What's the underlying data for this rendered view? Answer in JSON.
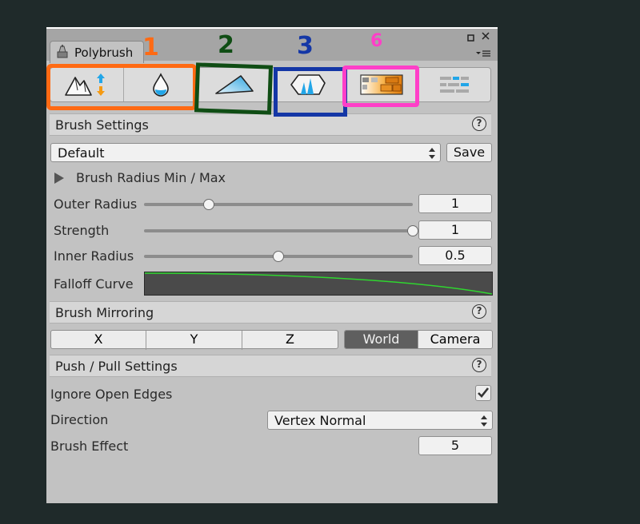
{
  "window": {
    "tab_title": "Polybrush",
    "tab_icon": "polybrush-icon",
    "controls": [
      "lock-icon",
      "close-icon",
      "menu-icon"
    ]
  },
  "modes": [
    {
      "name": "sculpt-mode",
      "icon": "mountain-arrows-icon"
    },
    {
      "name": "smooth-mode",
      "icon": "water-drop-icon"
    },
    {
      "name": "paint-vertex-mode",
      "icon": "triangle-icon"
    },
    {
      "name": "scatter-prefab-mode",
      "icon": "gem-prefab-icon"
    },
    {
      "name": "paint-texture-mode",
      "icon": "texture-blocks-icon"
    },
    {
      "name": "settings-mode",
      "icon": "list-settings-icon"
    }
  ],
  "annotations": [
    {
      "label": "1",
      "color": "#ff6a13"
    },
    {
      "label": "2",
      "color": "#0f4d14"
    },
    {
      "label": "3",
      "color": "#1437a6"
    },
    {
      "label": "6",
      "color": "#ff3fc8"
    }
  ],
  "brush_settings": {
    "header": "Brush Settings",
    "preset": "Default",
    "save_label": "Save",
    "radius_minmax": "Brush Radius Min / Max",
    "outer_radius": {
      "label": "Outer Radius",
      "value": "1",
      "fraction": 0.24
    },
    "strength": {
      "label": "Strength",
      "value": "1",
      "fraction": 1.0
    },
    "inner_radius": {
      "label": "Inner Radius",
      "value": "0.5",
      "fraction": 0.5
    },
    "falloff_label": "Falloff Curve",
    "curve_color": "#2fd62f"
  },
  "mirroring": {
    "header": "Brush Mirroring",
    "axes": [
      "X",
      "Y",
      "Z"
    ],
    "spaces": [
      "World",
      "Camera"
    ],
    "selected_space": "World"
  },
  "push_pull": {
    "header": "Push / Pull Settings",
    "ignore_open_edges": {
      "label": "Ignore Open Edges",
      "checked": true
    },
    "direction": {
      "label": "Direction",
      "value": "Vertex Normal"
    },
    "brush_effect": {
      "label": "Brush Effect",
      "value": "5"
    }
  },
  "colors": {
    "panel": "#c2c2c2",
    "background": "#1f2a2a",
    "selected_segment": "#5f5f5f"
  }
}
